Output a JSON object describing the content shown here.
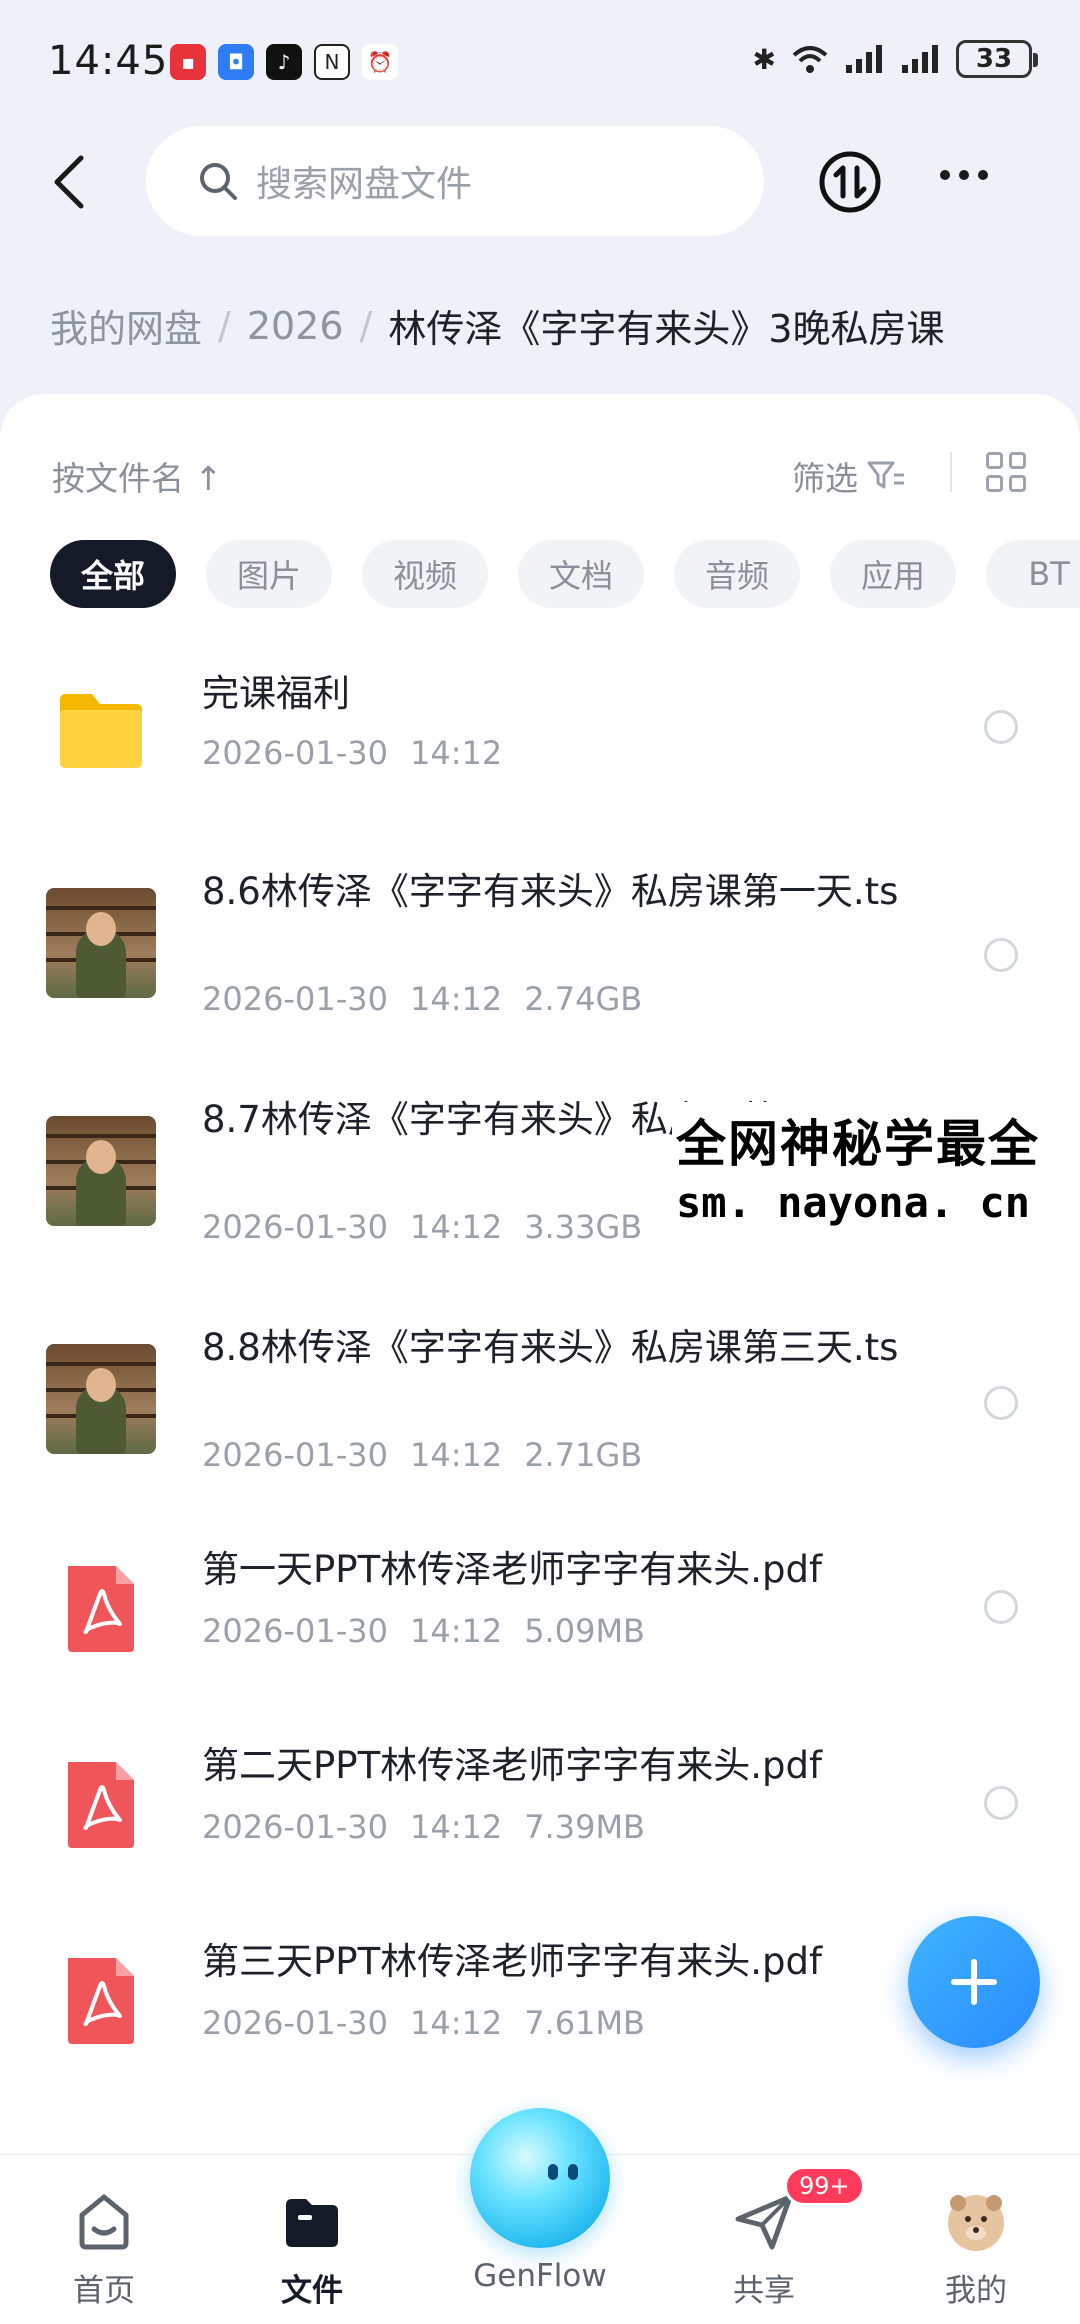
{
  "status_bar": {
    "time": "14:45",
    "battery": "33"
  },
  "header": {
    "search_placeholder": "搜索网盘文件"
  },
  "breadcrumb": {
    "items": [
      "我的网盘",
      "2026"
    ],
    "current": "林传泽《字字有来头》3晚私房课"
  },
  "toolbar": {
    "sort_label": "按文件名 ↑",
    "filter_label": "筛选"
  },
  "filters": [
    "全部",
    "图片",
    "视频",
    "文档",
    "音频",
    "应用",
    "BT"
  ],
  "files": [
    {
      "name": "完课福利",
      "date": "2026-01-30",
      "time": "14:12",
      "size": "",
      "type": "folder"
    },
    {
      "name": "8.6林传泽《字字有来头》私房课第一天.ts",
      "date": "2026-01-30",
      "time": "14:12",
      "size": "2.74GB",
      "type": "video"
    },
    {
      "name": "8.7林传泽《字字有来头》私房课第二天.ts",
      "date": "2026-01-30",
      "time": "14:12",
      "size": "3.33GB",
      "type": "video"
    },
    {
      "name": "8.8林传泽《字字有来头》私房课第三天.ts",
      "date": "2026-01-30",
      "time": "14:12",
      "size": "2.71GB",
      "type": "video"
    },
    {
      "name": "第一天PPT林传泽老师字字有来头.pdf",
      "date": "2026-01-30",
      "time": "14:12",
      "size": "5.09MB",
      "type": "pdf"
    },
    {
      "name": "第二天PPT林传泽老师字字有来头.pdf",
      "date": "2026-01-30",
      "time": "14:12",
      "size": "7.39MB",
      "type": "pdf"
    },
    {
      "name": "第三天PPT林传泽老师字字有来头.pdf",
      "date": "2026-01-30",
      "time": "14:12",
      "size": "7.61MB",
      "type": "pdf"
    }
  ],
  "watermark": {
    "line1": "全网神秘学最全",
    "line2": "sm. nayona. cn"
  },
  "bottom_nav": {
    "home": "首页",
    "files": "文件",
    "genflow": "GenFlow",
    "share": "共享",
    "share_badge": "99+",
    "me": "我的"
  },
  "colors": {
    "accent": "#2a8bff",
    "active_chip": "#141a27",
    "pdf_red": "#f0555a",
    "folder_yellow": "#ffcc2e"
  }
}
